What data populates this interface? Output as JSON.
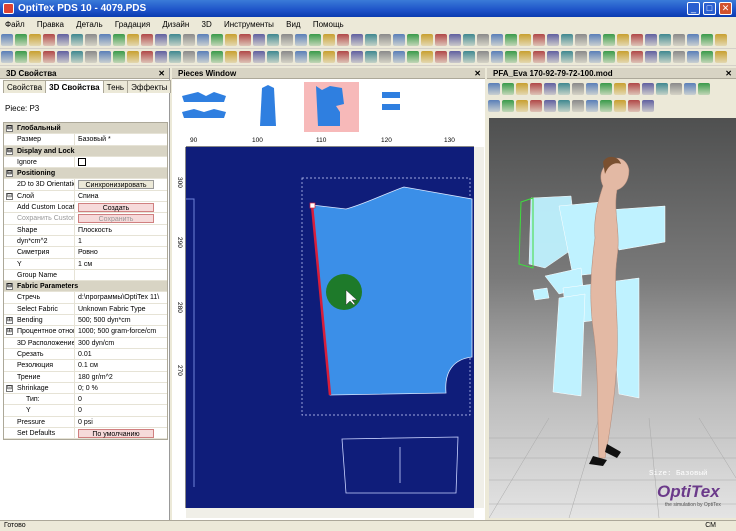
{
  "window": {
    "title": "OptiTex PDS 10 - 4079.PDS",
    "min": "_",
    "max": "□",
    "close": "✕"
  },
  "menu": [
    "Файл",
    "Правка",
    "Деталь",
    "Градация",
    "Дизайн",
    "3D",
    "Инструменты",
    "Вид",
    "Помощь"
  ],
  "left_panel": {
    "title": "3D Свойства",
    "tabs": [
      "Свойства",
      "3D Свойства",
      "Тень",
      "Эффекты"
    ],
    "piece": "Piece: P3",
    "rows": [
      {
        "type": "cat",
        "exp": "⊟",
        "k": "Глобальный"
      },
      {
        "k": "Размер",
        "v": "Базовый *"
      },
      {
        "type": "cat",
        "exp": "⊟",
        "k": "Display and Lock"
      },
      {
        "k": "Ignore",
        "v": "",
        "check": true
      },
      {
        "type": "cat",
        "exp": "⊟",
        "k": "Positioning"
      },
      {
        "k": "2D to 3D Orientation",
        "btn": "Синхронизировать"
      },
      {
        "exp": "⊟",
        "k": "Слой",
        "v": "Спина"
      },
      {
        "k": "Add Custom Locat",
        "btn": "Создать",
        "pink": true
      },
      {
        "k": "Сохранить Custom",
        "btn": "Сохранить",
        "pink": true,
        "grey": true
      },
      {
        "k": "Shape",
        "v": "Плоскость"
      },
      {
        "k": "dyn*cm^2",
        "v": "1"
      },
      {
        "k": "Симетрия",
        "v": "Ровно"
      },
      {
        "k": "Y",
        "v": "1 см"
      },
      {
        "k": "Group Name",
        "v": ""
      },
      {
        "type": "cat",
        "exp": "⊟",
        "k": "Fabric Parameters"
      },
      {
        "k": "Стречь",
        "v": "d:\\программы\\OptiTex 11\\"
      },
      {
        "k": "Select Fabric",
        "v": "Unknown Fabric Type"
      },
      {
        "exp": "⊞",
        "k": "Bending",
        "v": "500; 500 dyn*cm"
      },
      {
        "exp": "⊞",
        "k": "Процентное отноше",
        "v": "1000; 500 gram-force/cm"
      },
      {
        "k": "3D Расположение",
        "v": "300 dyn/cm"
      },
      {
        "k": "Срезать",
        "v": "0.01"
      },
      {
        "k": "Резолюция",
        "v": "0.1 см"
      },
      {
        "k": "Трение",
        "v": "180 gr/m^2"
      },
      {
        "exp": "⊟",
        "k": "Shrinkage",
        "v": "0; 0 %"
      },
      {
        "k": "Тип:",
        "v": "0",
        "indent": true
      },
      {
        "k": "Y",
        "v": "0",
        "indent": true
      },
      {
        "k": "Pressure",
        "v": "0 psi"
      },
      {
        "k": "Set Defaults",
        "btn": "По умолчанию",
        "pink": true
      }
    ]
  },
  "pieces_window": {
    "title": "Pieces Window",
    "ruler_top": [
      "90",
      "100",
      "110",
      "120",
      "130"
    ],
    "ruler_left": [
      "300",
      "290",
      "280",
      "270"
    ],
    "colors": {
      "canvas": "#0f1d7a",
      "piece": "#3b8fe8",
      "selected_edge": "#d81e3a",
      "cursor_dot": "#1e7a2a"
    }
  },
  "view3d": {
    "title": "PFA_Eva 170-92-79-72-100.mod",
    "size_label": "Size: Базовый",
    "logo": "OptiTex",
    "logo_tag": "the simulation by OptiTex"
  },
  "status": {
    "left": "Готово",
    "right": "СМ"
  }
}
